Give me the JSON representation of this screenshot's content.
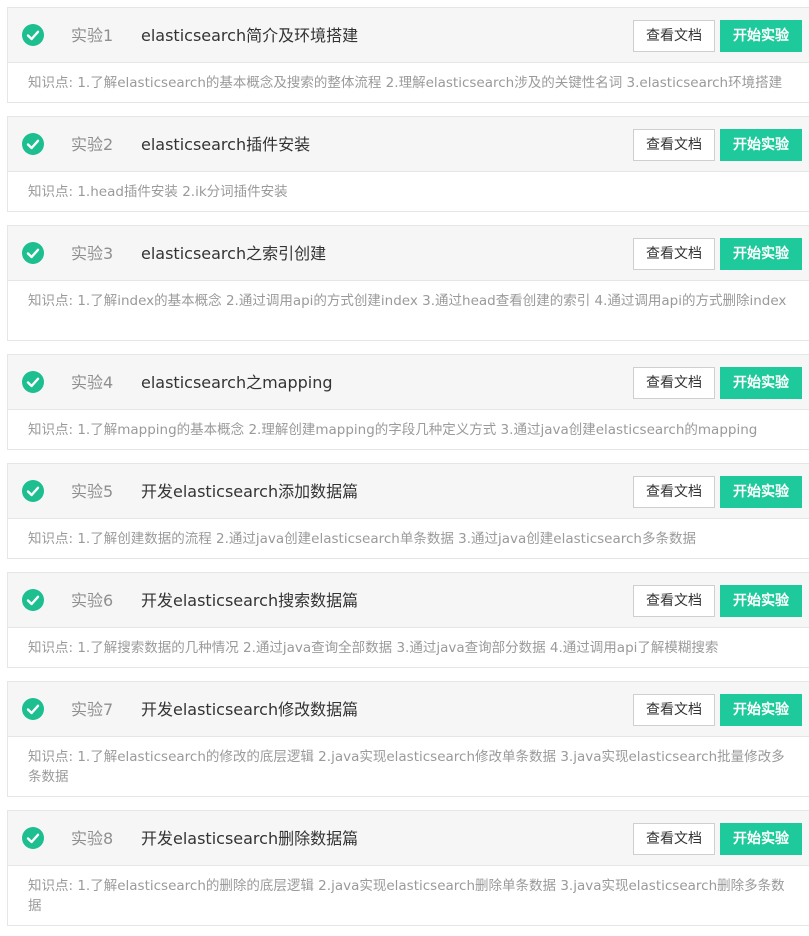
{
  "labs": [
    {
      "num": "实验1",
      "title": "elasticsearch简介及环境搭建",
      "knowledge": "知识点: 1.了解elasticsearch的基本概念及搜索的整体流程 2.理解elasticsearch涉及的关键性名词 3.elasticsearch环境搭建",
      "doc_label": "查看文档",
      "start_label": "开始实验",
      "completed": true
    },
    {
      "num": "实验2",
      "title": "elasticsearch插件安装",
      "knowledge": "知识点: 1.head插件安装 2.ik分词插件安装",
      "doc_label": "查看文档",
      "start_label": "开始实验",
      "completed": true
    },
    {
      "num": "实验3",
      "title": "elasticsearch之索引创建",
      "knowledge": "知识点: 1.了解index的基本概念 2.通过调用api的方式创建index 3.通过head查看创建的索引 4.通过调用api的方式删除index",
      "doc_label": "查看文档",
      "start_label": "开始实验",
      "completed": true
    },
    {
      "num": "实验4",
      "title": "elasticsearch之mapping",
      "knowledge": "知识点: 1.了解mapping的基本概念 2.理解创建mapping的字段几种定义方式 3.通过java创建elasticsearch的mapping",
      "doc_label": "查看文档",
      "start_label": "开始实验",
      "completed": true
    },
    {
      "num": "实验5",
      "title": "开发elasticsearch添加数据篇",
      "knowledge": "知识点: 1.了解创建数据的流程 2.通过java创建elasticsearch单条数据 3.通过java创建elasticsearch多条数据",
      "doc_label": "查看文档",
      "start_label": "开始实验",
      "completed": true
    },
    {
      "num": "实验6",
      "title": "开发elasticsearch搜索数据篇",
      "knowledge": "知识点: 1.了解搜索数据的几种情况 2.通过java查询全部数据 3.通过java查询部分数据 4.通过调用api了解模糊搜索",
      "doc_label": "查看文档",
      "start_label": "开始实验",
      "completed": true
    },
    {
      "num": "实验7",
      "title": "开发elasticsearch修改数据篇",
      "knowledge": "知识点: 1.了解elasticsearch的修改的底层逻辑 2.java实现elasticsearch修改单条数据 3.java实现elasticsearch批量修改多条数据",
      "doc_label": "查看文档",
      "start_label": "开始实验",
      "completed": true
    },
    {
      "num": "实验8",
      "title": "开发elasticsearch删除数据篇",
      "knowledge": "知识点: 1.了解elasticsearch的删除的底层逻辑 2.java实现elasticsearch删除单条数据 3.java实现elasticsearch删除多条数据",
      "doc_label": "查看文档",
      "start_label": "开始实验",
      "completed": true
    }
  ],
  "colors": {
    "accent": "#1ec99b",
    "check": "#1dbe8f",
    "header_bg": "#f6f6f6",
    "muted_text": "#9a9a9a"
  },
  "icons": {
    "completed": "check-circle-icon"
  }
}
